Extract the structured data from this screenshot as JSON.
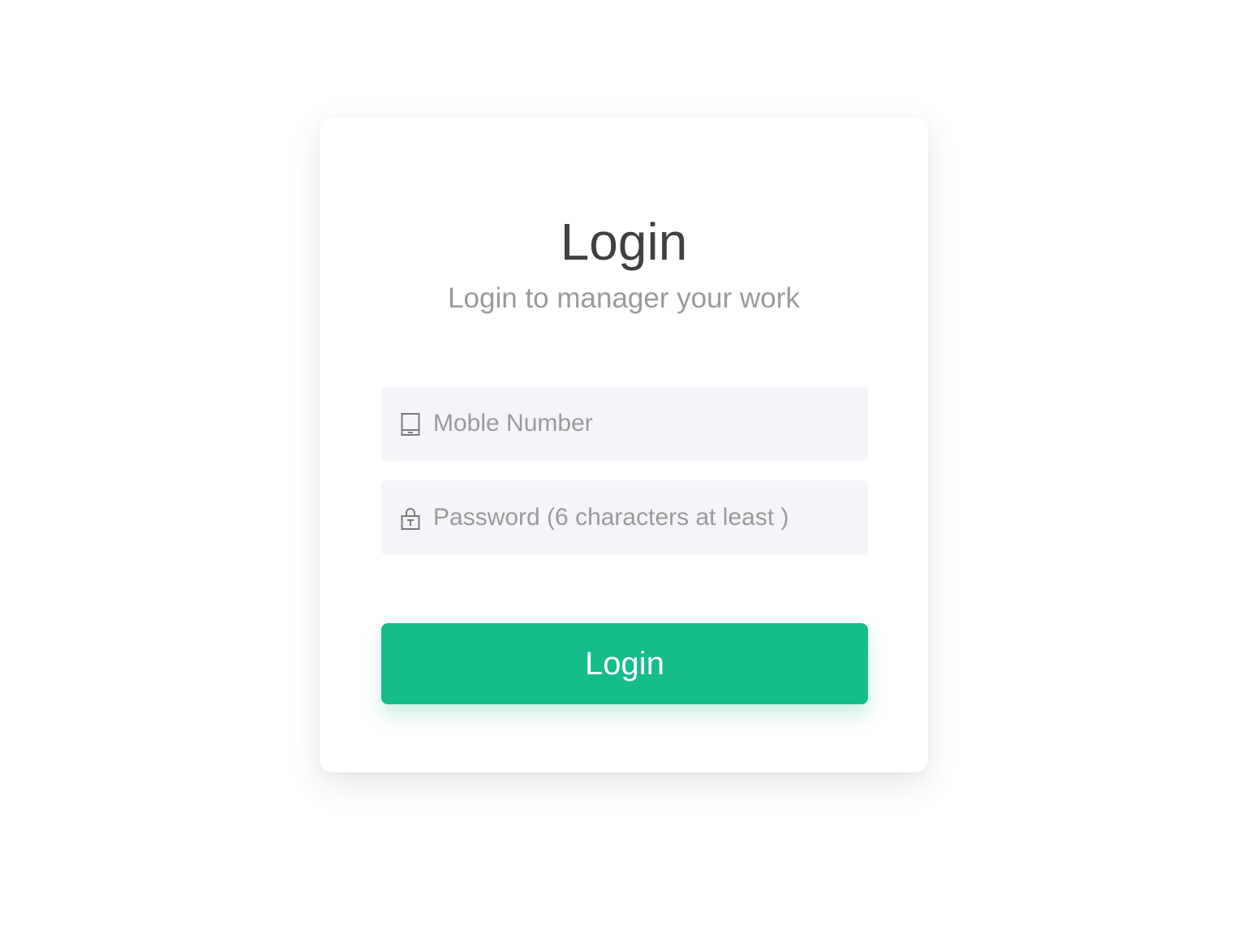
{
  "login_form": {
    "title": "Login",
    "subtitle": "Login to manager your work",
    "mobile": {
      "placeholder": "Moble Number",
      "value": "",
      "icon": "mobile-phone-icon"
    },
    "password": {
      "placeholder": "Password (6 characters at least )",
      "value": "",
      "icon": "lock-icon"
    },
    "submit_label": "Login"
  },
  "colors": {
    "accent": "#16bc8a",
    "field_background": "#f4f5f9",
    "title": "#404040",
    "muted_text": "#9a9a9a"
  }
}
